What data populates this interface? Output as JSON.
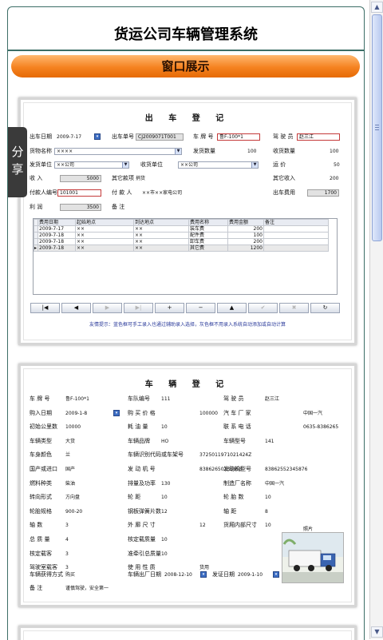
{
  "app": {
    "title": "货运公司车辆管理系统",
    "banner": "窗口展示",
    "share_tab": [
      "分",
      "享"
    ]
  },
  "scrollbar": {
    "up": "▲",
    "down": "▼"
  },
  "departure": {
    "title": "出 车 登 记",
    "departure_date": {
      "label": "出车日期",
      "value": "2009-7-17"
    },
    "order_no": {
      "label": "出车单号",
      "value": "CJ2009071T001"
    },
    "plate": {
      "label": "车 牌 号",
      "value": "鲁F-100*1"
    },
    "driver": {
      "label": "驾 驶 员",
      "value": "赵三江"
    },
    "goods": {
      "label": "货物名称",
      "value": "××××"
    },
    "ship_qty": {
      "label": "发货数量",
      "value": "100"
    },
    "recv_qty": {
      "label": "收货数量",
      "value": "100"
    },
    "sender": {
      "label": "发货单位",
      "value": "××公司"
    },
    "receiver": {
      "label": "收货单位",
      "value": "××公司"
    },
    "freight": {
      "label": "运 价",
      "value": "50"
    },
    "income": {
      "label": "收 入",
      "value": "5000"
    },
    "other_item": {
      "label": "其它款项",
      "value": "捎货"
    },
    "other_income": {
      "label": "其它收入",
      "value": "200"
    },
    "payer_no": {
      "label": "付款人编号",
      "value": "101001"
    },
    "payer": {
      "label": "付 款 人",
      "value": "××市××家电公司"
    },
    "cost": {
      "label": "出车费用",
      "value": "1700"
    },
    "profit": {
      "label": "利 润",
      "value": "3500"
    },
    "remark": {
      "label": "备 注",
      "value": ""
    },
    "grid_columns": [
      "费用日期",
      "起始地点",
      "到达地点",
      "费用名称",
      "费用金额",
      "备注"
    ],
    "grid_rows": [
      [
        "2009-7-17",
        "××",
        "××",
        "装车费",
        "200",
        ""
      ],
      [
        "2009-7-18",
        "××",
        "××",
        "配件费",
        "100",
        ""
      ],
      [
        "2009-7-18",
        "××",
        "××",
        "卸车费",
        "200",
        ""
      ],
      [
        "2009-7-18",
        "××",
        "××",
        "其它费",
        "1200",
        ""
      ]
    ],
    "nav_buttons": [
      "|◀",
      "◀",
      "▶",
      "▶|",
      "+",
      "−",
      "▲",
      "✔",
      "✖",
      "↻"
    ],
    "hint": "友情提示：蓝色框可手工录入也通过辅助录入选择，灰色框不用录入系统自动添加或自动计算"
  },
  "vehicle": {
    "title": "车 辆 登 记",
    "fields": [
      {
        "label": "车 牌 号",
        "value": "鲁F-100*1"
      },
      {
        "label": "车队编号",
        "value": "111"
      },
      {
        "label": "驾 驶 员",
        "value": "赵三江"
      },
      {
        "label": "购入日期",
        "value": "2009-1-8"
      },
      {
        "label": "购 买 价 格",
        "value": "100000"
      },
      {
        "label": "汽 车 厂 家",
        "value": "中国一汽"
      },
      {
        "label": "初始公里数",
        "value": "10000"
      },
      {
        "label": "耗 油 量",
        "value": "10"
      },
      {
        "label": "联 系 电 话",
        "value": "0635-8386265"
      },
      {
        "label": "车辆类型",
        "value": "大货"
      },
      {
        "label": "车辆品牌",
        "value": "HO"
      },
      {
        "label": "车辆型号",
        "value": "141"
      },
      {
        "label": "车身颜色",
        "value": "兰"
      },
      {
        "label": "车辆识别代码或车架号",
        "value": "3725011971021424Z"
      },
      {
        "label": "",
        "value": ""
      },
      {
        "label": "国产或进口",
        "value": "国产"
      },
      {
        "label": "发 动 机 号",
        "value": "83862650235658"
      },
      {
        "label": "发动机型号",
        "value": "83862552345876"
      },
      {
        "label": "燃料种类",
        "value": "柴油"
      },
      {
        "label": "排量及功率",
        "value": "130"
      },
      {
        "label": "制造厂名称",
        "value": "中国一汽"
      },
      {
        "label": "转向形式",
        "value": "方向盘"
      },
      {
        "label": "轮 距",
        "value": "10"
      },
      {
        "label": "轮 胎 数",
        "value": "10"
      },
      {
        "label": "轮胎规格",
        "value": "900-20"
      },
      {
        "label": "钢板弹簧片数",
        "value": "12"
      },
      {
        "label": "轴 距",
        "value": "8"
      },
      {
        "label": "轴 数",
        "value": "3"
      },
      {
        "label": "外 廓 尺 寸",
        "value": "12"
      },
      {
        "label": "货厢内部尺寸",
        "value": "10"
      },
      {
        "label": "总 质 量",
        "value": "4"
      },
      {
        "label": "核定载质量",
        "value": "10"
      },
      {
        "label": "",
        "value": ""
      },
      {
        "label": "核定载客",
        "value": "3"
      },
      {
        "label": "准牵引总质量",
        "value": "10"
      },
      {
        "label": "",
        "value": ""
      },
      {
        "label": "驾驶室载客",
        "value": "3"
      },
      {
        "label": "使 用 性 质",
        "value": "货用"
      },
      {
        "label": "",
        "value": ""
      }
    ],
    "acquire": {
      "label": "车辆获得方式",
      "value": "购买"
    },
    "factory_date": {
      "label": "车辆出厂日期",
      "value": "2008-12-10"
    },
    "issue_date": {
      "label": "发证日期",
      "value": "2009-1-10"
    },
    "remark": {
      "label": "备 注",
      "value": "谨慎驾驶，安全第一"
    },
    "photo_label": "照片"
  },
  "colors": {
    "banner": "#f58220",
    "frame": "#3c6e66",
    "hint": "#2a3a9a"
  },
  "icons": {
    "calendar": "calendar-icon",
    "dropdown": "chevron-down-icon",
    "truck": "truck-photo"
  }
}
